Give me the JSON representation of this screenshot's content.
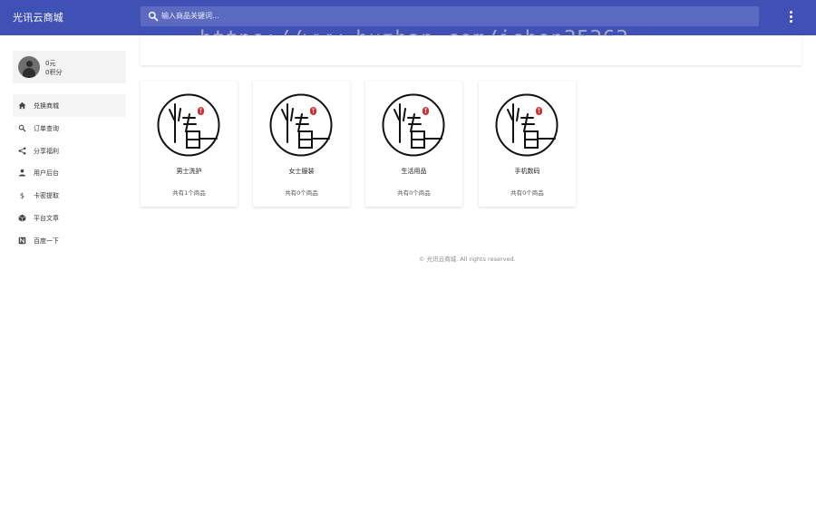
{
  "header": {
    "brand": "光讯云商城",
    "search_placeholder": "输入商品关键词..."
  },
  "watermark": "https://www.huzhan.com/ishop35363",
  "user": {
    "balance": "0元",
    "points": "0积分"
  },
  "nav": [
    {
      "label": "兑换商城",
      "icon": "home-icon"
    },
    {
      "label": "订单查询",
      "icon": "search-icon"
    },
    {
      "label": "分享福利",
      "icon": "share-icon"
    },
    {
      "label": "用户后台",
      "icon": "person-icon"
    },
    {
      "label": "卡密提取",
      "icon": "dollar-icon"
    },
    {
      "label": "平台文章",
      "icon": "package-icon"
    },
    {
      "label": "百度一下",
      "icon": "baidu-icon"
    }
  ],
  "categories": [
    {
      "title": "男士洗护",
      "count": "共有1个商品"
    },
    {
      "title": "女士服装",
      "count": "共有0个商品"
    },
    {
      "title": "生活用品",
      "count": "共有0个商品"
    },
    {
      "title": "手机数码",
      "count": "共有0个商品"
    }
  ],
  "footer": "© 光讯云商城. All rights reserved.",
  "colors": {
    "primary": "#3f51b5",
    "search_bg": "#5c6bc0",
    "seal_red": "#d32f2f"
  }
}
